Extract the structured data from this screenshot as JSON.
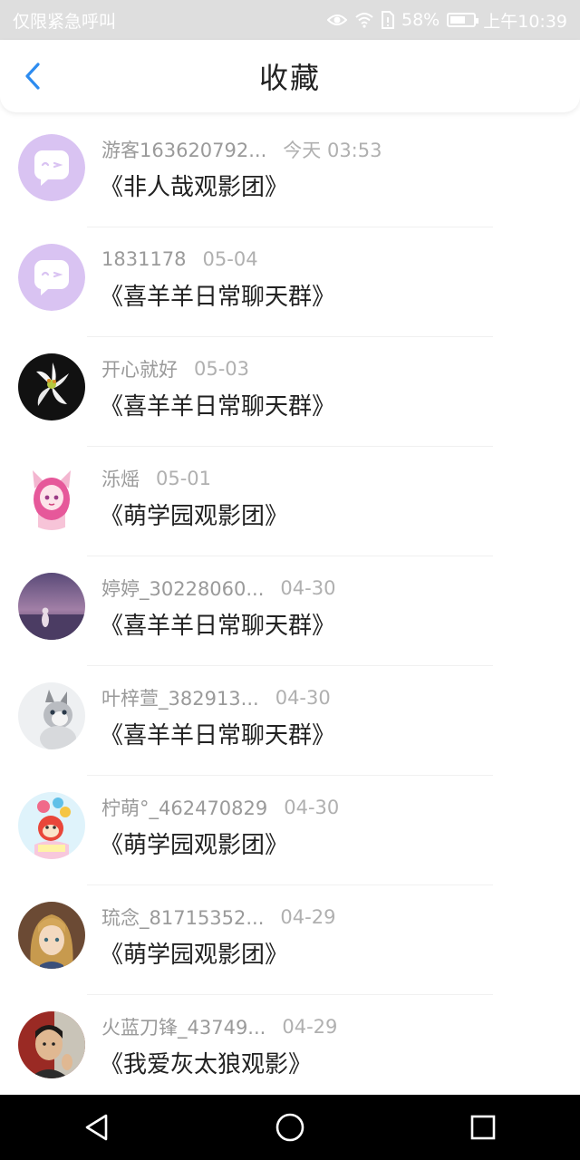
{
  "status_bar": {
    "left_text": "仅限紧急呼叫",
    "battery": "58%",
    "time": "上午10:39",
    "icons": [
      "eye-icon",
      "wifi-icon",
      "sim-icon",
      "battery-icon"
    ]
  },
  "header": {
    "title": "收藏",
    "back_icon": "chevron-left-icon"
  },
  "colors": {
    "accent": "#2d8cf0",
    "default_avatar_bg": "#d9c3f2"
  },
  "items": [
    {
      "user": "游客163620792...",
      "time": "今天 03:53",
      "group": "《非人哉观影团》",
      "avatar": "default-chat-avatar"
    },
    {
      "user": "1831178",
      "time": "05-04",
      "group": "《喜羊羊日常聊天群》",
      "avatar": "default-chat-avatar"
    },
    {
      "user": "⁢⁢开心就好",
      "time": "05-03",
      "group": "《喜羊羊日常聊天群》",
      "avatar": "lily-flower-avatar"
    },
    {
      "user": "泺熎",
      "time": "05-01",
      "group": "《萌学园观影团》",
      "avatar": "anime-girl-avatar"
    },
    {
      "user": "婷婷_30228060...",
      "time": "04-30",
      "group": "《喜羊羊日常聊天群》",
      "avatar": "sunset-avatar"
    },
    {
      "user": "叶梓萱_382913...",
      "time": "04-30",
      "group": "《喜羊羊日常聊天群》",
      "avatar": "kitten-avatar"
    },
    {
      "user": "柠萌°_462470829",
      "time": "04-30",
      "group": "《萌学园观影团》",
      "avatar": "cartoon-avatar"
    },
    {
      "user": "琉念_81715352...",
      "time": "04-29",
      "group": "《萌学园观影团》",
      "avatar": "anime-portrait-avatar"
    },
    {
      "user": "火蓝刀锋_43749...",
      "time": "04-29",
      "group": "《我爱灰太狼观影》",
      "avatar": "photo-avatar"
    }
  ],
  "nav_bar": {
    "buttons": [
      "back-triangle-icon",
      "home-circle-icon",
      "recents-square-icon"
    ]
  }
}
